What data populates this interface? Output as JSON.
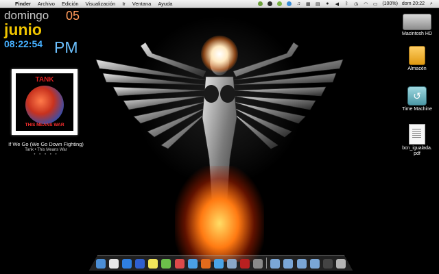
{
  "menubar": {
    "apple_glyph": "",
    "items": [
      "Finder",
      "Archivo",
      "Edición",
      "Visualización",
      "Ir",
      "Ventana",
      "Ayuda"
    ],
    "battery": "(100%)",
    "clock": "dom 20:22",
    "status_icons": [
      "spotlight-icon",
      "cloud-icon",
      "skype-icon",
      "adium-icon",
      "twitter-icon",
      "music-note-icon",
      "calendar-icon",
      "bag-icon",
      "cat-icon",
      "volume-icon",
      "bluetooth-icon",
      "timemachine-icon",
      "wifi-icon",
      "battery-icon",
      "search-icon"
    ]
  },
  "clock_widget": {
    "day": "domingo",
    "date": "05",
    "month": "junio",
    "time": "08:22:54",
    "ampm": "PM"
  },
  "itunes_widget": {
    "album_band": "TANK",
    "album_title": "THIS MEANS WAR",
    "song": "If We Go (We Go Down Fighting)",
    "artist_album": "Tank • This Means War",
    "rating": "• • • • •"
  },
  "desktop_icons": [
    {
      "label": "Macintosh HD",
      "icon": "harddrive-icon"
    },
    {
      "label": "Almacén",
      "icon": "usb-drive-icon"
    },
    {
      "label": "Time Machine",
      "icon": "timemachine-drive-icon"
    },
    {
      "label": "bcn_igualada.\npdf",
      "icon": "pdf-file-icon"
    }
  ],
  "colors": {
    "clock_day": "#c8c8c8",
    "clock_date": "#ff9a5a",
    "clock_month": "#f0c500",
    "clock_time": "#46b0ff"
  },
  "dock": {
    "apps": [
      {
        "name": "finder-icon",
        "color": "#4c8fd6"
      },
      {
        "name": "ical-icon",
        "color": "#e8e8e8"
      },
      {
        "name": "appstore-icon",
        "color": "#2f7fe0"
      },
      {
        "name": "itunes-icon",
        "color": "#2f5fd0"
      },
      {
        "name": "stickies-icon",
        "color": "#f2e55a"
      },
      {
        "name": "adium-duck-icon",
        "color": "#6cc04a"
      },
      {
        "name": "music-icon",
        "color": "#dd4a4a"
      },
      {
        "name": "chat-bubble-icon",
        "color": "#4aa0e6"
      },
      {
        "name": "firefox-icon",
        "color": "#e26b1c"
      },
      {
        "name": "twitter-bird-icon",
        "color": "#4aa4e6"
      },
      {
        "name": "mail-icon",
        "color": "#8aa7c7"
      },
      {
        "name": "red-dots-icon",
        "color": "#b92020"
      },
      {
        "name": "settings-icon",
        "color": "#8a8a8a"
      }
    ],
    "right": [
      {
        "name": "folder-icon",
        "color": "#7aa6d6"
      },
      {
        "name": "folder-icon",
        "color": "#7aa6d6"
      },
      {
        "name": "folder-icon",
        "color": "#7aa6d6"
      },
      {
        "name": "downloads-icon",
        "color": "#7aa6d6"
      },
      {
        "name": "stack-icon",
        "color": "#444"
      },
      {
        "name": "trash-icon",
        "color": "#b5b5b5"
      }
    ]
  }
}
